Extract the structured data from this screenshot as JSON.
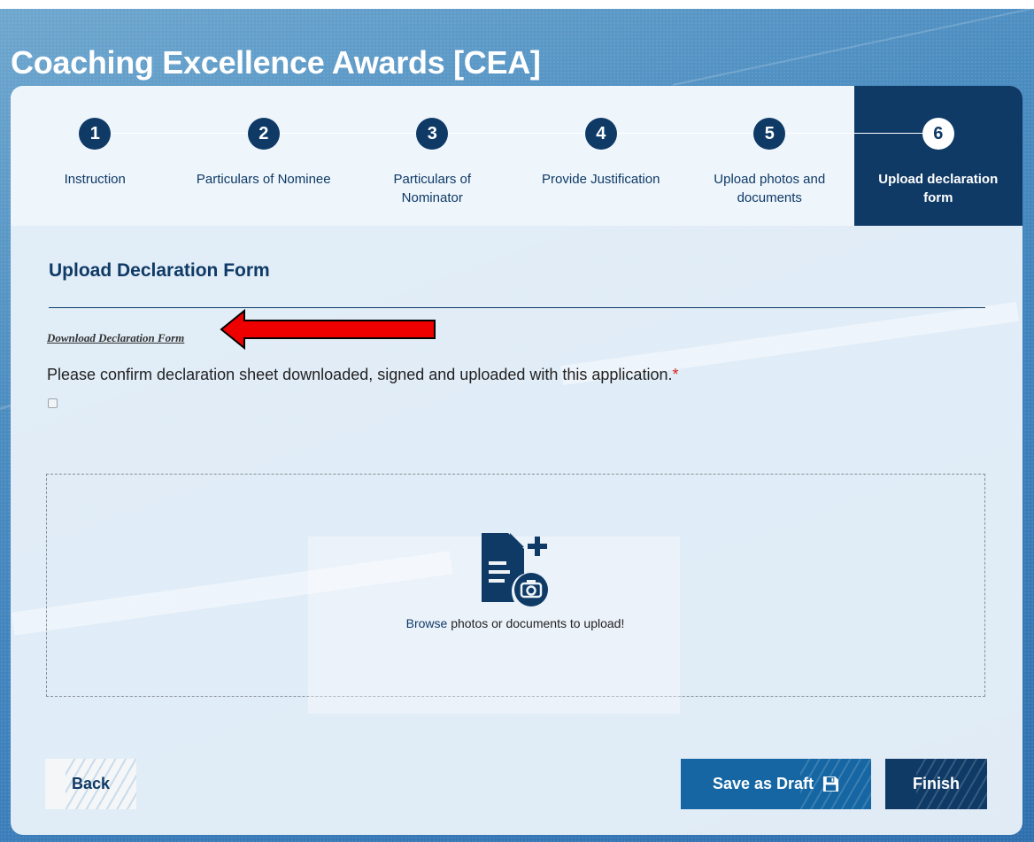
{
  "page": {
    "title": "Coaching Excellence Awards [CEA]"
  },
  "stepper": {
    "steps": [
      {
        "number": "1",
        "label": "Instruction"
      },
      {
        "number": "2",
        "label": "Particulars of Nominee"
      },
      {
        "number": "3",
        "label": "Particulars of Nominator"
      },
      {
        "number": "4",
        "label": "Provide Justification"
      },
      {
        "number": "5",
        "label": "Upload photos and documents"
      },
      {
        "number": "6",
        "label": "Upload declaration form"
      }
    ],
    "active_step": 6
  },
  "form": {
    "section_title": "Upload Declaration Form",
    "download_link": "Download Declaration Form",
    "confirm_label": "Please confirm declaration sheet downloaded, signed and uploaded with this application.",
    "required_marker": "*",
    "confirm_checked": false
  },
  "dropzone": {
    "icon": "document-camera-upload-icon",
    "browse_link": "Browse",
    "browse_rest": " photos or documents to upload!"
  },
  "actions": {
    "back_label": "Back",
    "save_draft_label": "Save as Draft",
    "save_icon": "save-icon",
    "finish_label": "Finish"
  },
  "colors": {
    "primary": "#0f3a66",
    "secondary": "#1566a3",
    "required": "#d9251c",
    "annotation_arrow": "#ee0000"
  }
}
